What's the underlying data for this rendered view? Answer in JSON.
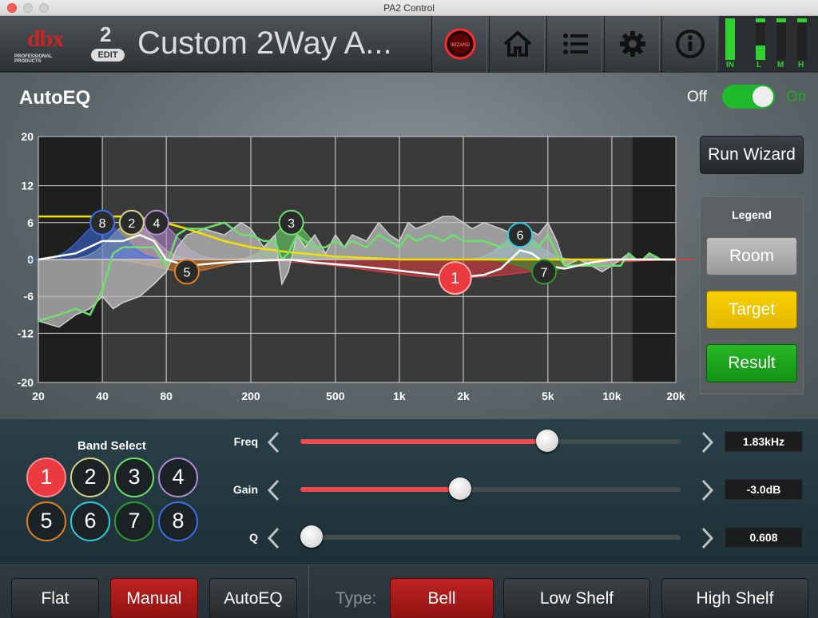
{
  "window": {
    "title": "PA2 Control"
  },
  "header": {
    "logo_text": "dbx",
    "logo_sub": "PROFESSIONAL PRODUCTS",
    "preset_number": "2",
    "edit_badge": "EDIT",
    "preset_title": "Custom 2Way A...",
    "buttons": [
      "wizard-icon",
      "home-icon",
      "list-icon",
      "gear-icon",
      "info-icon"
    ],
    "meters": [
      {
        "label": "IN",
        "level": 1.0,
        "color": "#2fd02f"
      },
      {
        "label": "L",
        "level": 0.35,
        "color": "#2fd02f"
      },
      {
        "label": "M",
        "level": 0.0,
        "color": "#2fd02f"
      },
      {
        "label": "H",
        "level": 0.0,
        "color": "#2fd02f"
      }
    ]
  },
  "page": {
    "title": "AutoEQ",
    "toggle_off": "Off",
    "toggle_on": "On",
    "toggle_state": "on"
  },
  "chart_data": {
    "type": "line",
    "x_scale": "log",
    "xlim": [
      20,
      20000
    ],
    "ylim": [
      -20,
      20
    ],
    "y_ticks": [
      "20",
      "12",
      "6",
      "0",
      "-6",
      "-12",
      "-20"
    ],
    "y_tick_values": [
      20,
      12,
      6,
      0,
      -6,
      -12,
      -20
    ],
    "x_ticks": [
      "20",
      "40",
      "80",
      "200",
      "500",
      "1k",
      "2k",
      "5k",
      "10k",
      "20k"
    ],
    "x_tick_values": [
      20,
      40,
      80,
      200,
      500,
      1000,
      2000,
      5000,
      10000,
      20000
    ],
    "shaded_ranges": [
      [
        20,
        40
      ],
      [
        12500,
        20000
      ]
    ],
    "grid": true,
    "series": [
      {
        "name": "Room",
        "color": "#bdbdbd",
        "x": [
          20,
          25,
          30,
          35,
          40,
          45,
          50,
          60,
          70,
          80,
          90,
          100,
          120,
          150,
          180,
          200,
          230,
          260,
          280,
          300,
          330,
          360,
          400,
          450,
          500,
          550,
          600,
          700,
          800,
          900,
          1000,
          1100,
          1200,
          1400,
          1600,
          1800,
          2000,
          2200,
          2500,
          3000,
          3500,
          4000,
          4500,
          5000,
          5500,
          6000,
          7000,
          8000,
          9000,
          10000,
          11000,
          12000,
          13000,
          14000,
          15000,
          17000,
          20000
        ],
        "y": [
          -10,
          -11,
          -9,
          -8,
          -6,
          -8,
          -7,
          -6,
          -4,
          -2,
          2,
          4,
          5,
          4,
          6,
          5,
          2,
          4,
          -4,
          -2,
          4,
          2,
          4,
          1,
          4,
          2,
          4,
          3,
          6,
          4,
          3,
          6,
          5,
          6,
          7,
          7,
          6,
          5,
          6,
          5,
          4,
          5,
          4,
          6,
          3,
          -1,
          0,
          -1,
          -2,
          -1,
          0,
          1,
          0,
          0,
          1,
          0,
          0
        ]
      },
      {
        "name": "Target",
        "color": "#f2e000",
        "x": [
          20,
          50,
          70,
          100,
          150,
          200,
          300,
          500,
          1000,
          2000,
          5000,
          10000,
          20000
        ],
        "y": [
          7,
          7,
          6.5,
          5,
          3,
          2,
          1.2,
          0.5,
          0,
          0,
          0,
          0,
          0
        ]
      },
      {
        "name": "Result",
        "color": "#6de06d",
        "x": [
          20,
          25,
          30,
          35,
          40,
          45,
          50,
          60,
          70,
          80,
          90,
          100,
          120,
          150,
          180,
          200,
          230,
          260,
          280,
          300,
          330,
          360,
          400,
          450,
          500,
          550,
          600,
          700,
          800,
          900,
          1000,
          1100,
          1200,
          1400,
          1600,
          1800,
          2000,
          2200,
          2500,
          3000,
          3500,
          4000,
          4500,
          5000,
          5500,
          6000,
          7000,
          8000,
          9000,
          10000,
          11000,
          12000,
          13000,
          14000,
          15000,
          17000,
          20000
        ],
        "y": [
          -10,
          -9,
          -8,
          -9,
          -5,
          1,
          2,
          2,
          2,
          -1,
          4,
          5,
          5,
          6,
          4,
          4,
          3,
          3,
          0,
          1,
          4,
          3,
          2,
          2,
          3,
          2,
          3,
          2,
          4,
          3,
          2,
          4,
          3,
          4,
          3,
          4,
          3,
          3,
          3,
          2,
          3,
          3,
          2,
          4,
          1,
          -1,
          -1,
          -1,
          -1,
          -1,
          -1,
          1,
          0,
          0,
          1,
          0,
          0
        ]
      },
      {
        "name": "EQ",
        "color": "#ffffff",
        "x": [
          20,
          30,
          40,
          50,
          60,
          70,
          80,
          100,
          150,
          200,
          300,
          400,
          600,
          1000,
          1500,
          1830,
          2500,
          3000,
          3700,
          4200,
          5000,
          6000,
          8000,
          10000,
          20000
        ],
        "y": [
          0,
          1,
          3,
          3,
          4,
          3,
          0,
          -1,
          -0.5,
          -0.3,
          0,
          -0.5,
          -1,
          -1.8,
          -2.5,
          -3,
          -2.5,
          -1.5,
          1.5,
          1,
          -1,
          -1.5,
          -0.5,
          0,
          0
        ]
      }
    ],
    "bands": [
      {
        "id": "1",
        "freq": 1830,
        "gain": -3.0,
        "color": "#ea3a40",
        "selected": true
      },
      {
        "id": "2",
        "freq": 55,
        "gain": 6,
        "color": "#d6d38a"
      },
      {
        "id": "3",
        "freq": 310,
        "gain": 6,
        "color": "#6de06d"
      },
      {
        "id": "4",
        "freq": 72,
        "gain": 6,
        "color": "#b58ad6"
      },
      {
        "id": "5",
        "freq": 100,
        "gain": -2,
        "color": "#e07f2a"
      },
      {
        "id": "6",
        "freq": 3700,
        "gain": 4,
        "color": "#30c9d8"
      },
      {
        "id": "7",
        "freq": 4800,
        "gain": -2,
        "color": "#2f9a2f"
      },
      {
        "id": "8",
        "freq": 40,
        "gain": 6,
        "color": "#3d6ee8"
      }
    ]
  },
  "side": {
    "run_wizard": "Run Wizard",
    "legend_title": "Legend",
    "legend_room": "Room",
    "legend_target": "Target",
    "legend_result": "Result"
  },
  "controls": {
    "band_select_label": "Band Select",
    "bands": [
      {
        "label": "1",
        "color": "#ff8a8e",
        "selected": true
      },
      {
        "label": "2",
        "color": "#d6d38a"
      },
      {
        "label": "3",
        "color": "#6de06d"
      },
      {
        "label": "4",
        "color": "#b58ad6"
      },
      {
        "label": "5",
        "color": "#e07f2a"
      },
      {
        "label": "6",
        "color": "#30c9d8"
      },
      {
        "label": "7",
        "color": "#2f9a2f"
      },
      {
        "label": "8",
        "color": "#3d6ee8"
      }
    ],
    "params": [
      {
        "label": "Freq",
        "value": "1.83kHz",
        "level": 0.65
      },
      {
        "label": "Gain",
        "value": "-3.0dB",
        "level": 0.42
      },
      {
        "label": "Q",
        "value": "0.608",
        "level": 0.03
      }
    ]
  },
  "footer": {
    "mode_flat": "Flat",
    "mode_manual": "Manual",
    "mode_autoeq": "AutoEQ",
    "type_label": "Type:",
    "type_bell": "Bell",
    "type_low_shelf": "Low Shelf",
    "type_high_shelf": "High Shelf"
  }
}
